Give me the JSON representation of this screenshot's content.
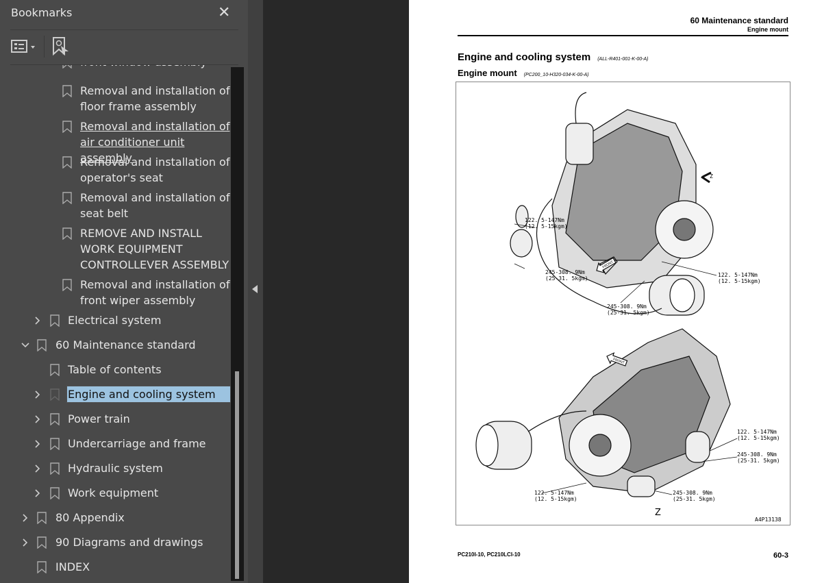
{
  "sidebar": {
    "title": "Bookmarks",
    "close_icon": "close-icon",
    "toolbar": {
      "options_icon": "list-options-icon",
      "find_icon": "find-bookmark-icon"
    },
    "items": [
      {
        "label": "front window assembly",
        "level": 3,
        "has_children": false
      },
      {
        "label": "Removal and installation of\nfloor frame assembly",
        "level": 3,
        "has_children": false
      },
      {
        "label": "Removal and installation of\nair conditioner unit assembly",
        "level": 3,
        "has_children": false,
        "hovered": true
      },
      {
        "label": "Removal and installation of\noperator's seat",
        "level": 3,
        "has_children": false
      },
      {
        "label": "Removal and installation of\nseat belt",
        "level": 3,
        "has_children": false
      },
      {
        "label": "REMOVE AND INSTALL\nWORK EQUIPMENT\nCONTROLLEVER ASSEMBLY",
        "level": 3,
        "has_children": false
      },
      {
        "label": "Removal and installation of\nfront wiper assembly",
        "level": 3,
        "has_children": false
      },
      {
        "label": "Electrical system",
        "level": 2,
        "has_children": true,
        "expanded": false
      },
      {
        "label": "60 Maintenance standard",
        "level": 1,
        "has_children": true,
        "expanded": true
      },
      {
        "label": "Table of contents",
        "level": 2,
        "has_children": false
      },
      {
        "label": "Engine and cooling system",
        "level": 2,
        "has_children": true,
        "expanded": false,
        "selected": true
      },
      {
        "label": "Power train",
        "level": 2,
        "has_children": true,
        "expanded": false
      },
      {
        "label": "Undercarriage and frame",
        "level": 2,
        "has_children": true,
        "expanded": false
      },
      {
        "label": "Hydraulic system",
        "level": 2,
        "has_children": true,
        "expanded": false
      },
      {
        "label": "Work equipment",
        "level": 2,
        "has_children": true,
        "expanded": false
      },
      {
        "label": "80 Appendix",
        "level": 1,
        "has_children": true,
        "expanded": false
      },
      {
        "label": "90 Diagrams and drawings",
        "level": 1,
        "has_children": true,
        "expanded": false
      },
      {
        "label": "INDEX",
        "level": 1,
        "has_children": false
      }
    ],
    "selected_color": "#9cc3e0"
  },
  "page": {
    "header_section": "60 Maintenance standard",
    "header_sub": "Engine mount",
    "heading1": "Engine and cooling system",
    "heading1_code": "(ALL-R401-001-K-00-A)",
    "heading2": "Engine mount",
    "heading2_code": "(PC200_10-H320-034-K-00-A)",
    "figure": {
      "top_labels": [
        {
          "nm": "122. 5-147Nm",
          "kgm": "(12. 5-15kgm)"
        },
        {
          "nm": "245-308. 9Nm",
          "kgm": "(25-31. 5kgm)"
        },
        {
          "nm": "122. 5-147Nm",
          "kgm": "(12. 5-15kgm)"
        },
        {
          "nm": "245-308. 9Nm",
          "kgm": "(25-31. 5kgm)"
        }
      ],
      "bottom_labels": [
        {
          "nm": "122. 5-147Nm",
          "kgm": "(12. 5-15kgm)"
        },
        {
          "nm": "245-308. 9Nm",
          "kgm": "(25-31. 5kgm)"
        },
        {
          "nm": "122. 5-147Nm",
          "kgm": "(12. 5-15kgm)"
        },
        {
          "nm": "245-308. 9Nm",
          "kgm": "(25-31. 5kgm)"
        }
      ],
      "view_letter": "Z",
      "front_label": "FRONT",
      "figure_id": "A4P13138"
    },
    "footer_model": "PC210I-10, PC210LCI-10",
    "page_number": "60-3"
  }
}
